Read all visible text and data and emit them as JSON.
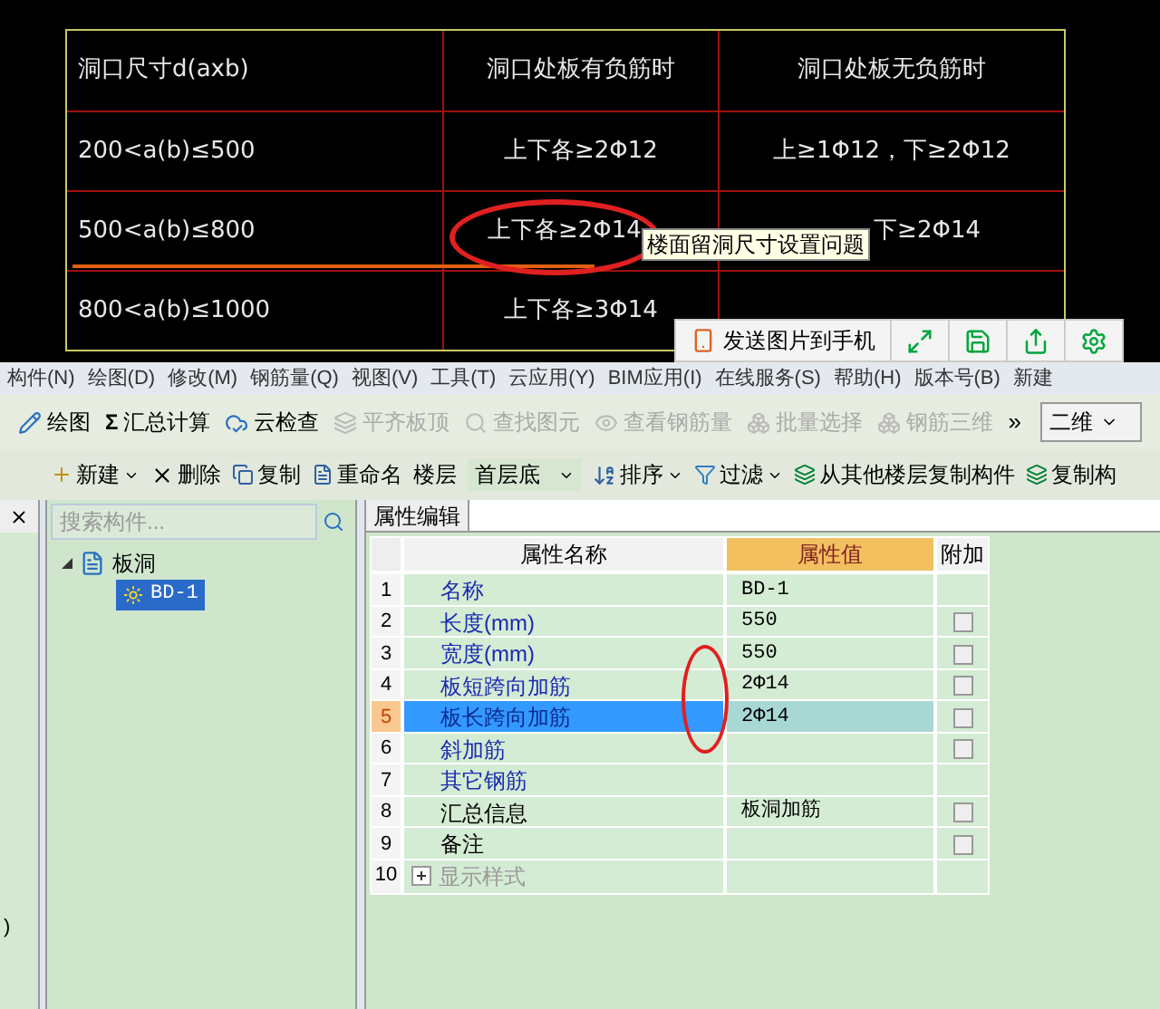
{
  "cad_table": {
    "headers": [
      "洞口尺寸d(axb)",
      "洞口处板有负筋时",
      "洞口处板无负筋时"
    ],
    "rows": [
      [
        "200<a(b)≤500",
        "上下各≥2Φ12",
        "上≥1Φ12，下≥2Φ12"
      ],
      [
        "500<a(b)≤800",
        "上下各≥2Φ14",
        "下≥2Φ14"
      ],
      [
        "800<a(b)≤1000",
        "上下各≥3Φ14"
      ]
    ]
  },
  "tooltip": "楼面留洞尺寸设置问题",
  "float_toolbar": {
    "send_label": "发送图片到手机"
  },
  "menu": [
    "构件(N)",
    "绘图(D)",
    "修改(M)",
    "钢筋量(Q)",
    "视图(V)",
    "工具(T)",
    "云应用(Y)",
    "BIM应用(I)",
    "在线服务(S)",
    "帮助(H)",
    "版本号(B)",
    "新建"
  ],
  "toolbar1": [
    {
      "label": "绘图",
      "disabled": false
    },
    {
      "label": "汇总计算",
      "icon_text": "Σ",
      "disabled": false
    },
    {
      "label": "云检查",
      "disabled": false
    },
    {
      "label": "平齐板顶",
      "disabled": true
    },
    {
      "label": "查找图元",
      "disabled": true
    },
    {
      "label": "查看钢筋量",
      "disabled": true
    },
    {
      "label": "批量选择",
      "disabled": true
    },
    {
      "label": "钢筋三维",
      "disabled": true
    }
  ],
  "more": "»",
  "view_select": "二维",
  "toolbar2": {
    "new": "新建",
    "delete": "删除",
    "copy": "复制",
    "rename": "重命名",
    "floor_label": "楼层",
    "floor_value": "首层底",
    "sort": "排序",
    "filter": "过滤",
    "copy_from": "从其他楼层复制构件",
    "copy_part": "复制构"
  },
  "left_strip_text": ")",
  "search": {
    "placeholder": "搜索构件..."
  },
  "tree": [
    {
      "label": "板洞",
      "expanded": true,
      "selected": false,
      "children": [
        {
          "label": "BD-1",
          "selected": true
        }
      ]
    }
  ],
  "tab": "属性编辑",
  "columns": [
    "属性名称",
    "属性值",
    "附加"
  ],
  "rows": [
    {
      "num": "1",
      "name": "名称",
      "value": "BD-1",
      "kind": "param",
      "selected": false
    },
    {
      "num": "2",
      "name": "长度(mm)",
      "value": "550",
      "kind": "param",
      "selected": false,
      "checked": false
    },
    {
      "num": "3",
      "name": "宽度(mm)",
      "value": "550",
      "kind": "param",
      "selected": false,
      "checked": false
    },
    {
      "num": "4",
      "name": "板短跨向加筋",
      "value": "2Φ14",
      "kind": "param",
      "selected": false,
      "checked": false
    },
    {
      "num": "5",
      "name": "板长跨向加筋",
      "value": "2Φ14",
      "kind": "param",
      "selected": true,
      "checked": false
    },
    {
      "num": "6",
      "name": "斜加筋",
      "kind": "param",
      "selected": false,
      "checked": false
    },
    {
      "num": "7",
      "name": "其它钢筋",
      "kind": "param",
      "selected": false
    },
    {
      "num": "8",
      "name": "汇总信息",
      "value": "板洞加筋",
      "kind": "info",
      "selected": false,
      "checked": false
    },
    {
      "num": "9",
      "name": "备注",
      "kind": "info",
      "selected": false,
      "checked": false
    },
    {
      "num": "10",
      "name": "显示样式",
      "kind": "group",
      "selected": false,
      "expanded": false
    }
  ]
}
